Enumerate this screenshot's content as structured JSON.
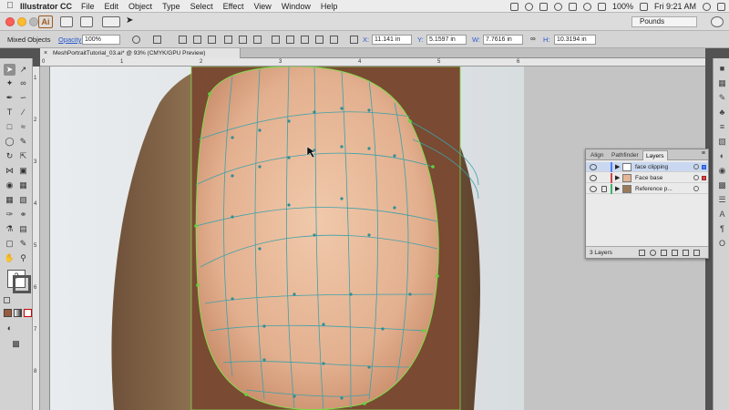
{
  "menubar": {
    "app_name": "Illustrator CC",
    "items": [
      "File",
      "Edit",
      "Object",
      "Type",
      "Select",
      "Effect",
      "View",
      "Window",
      "Help"
    ],
    "battery": "100%",
    "clock": "Fri 9:21 AM"
  },
  "appbar": {
    "logo": "Ai",
    "workspace": "Pounds"
  },
  "controlbar": {
    "selection_label": "Mixed Objects",
    "opacity_label": "Opacity",
    "opacity_value": "100%",
    "x_label": "X:",
    "x_value": "11.141 in",
    "y_label": "Y:",
    "y_value": "5.1597 in",
    "w_label": "W:",
    "w_value": "7.7616 in",
    "h_label": "H:",
    "h_value": "10.3194 in"
  },
  "document": {
    "tab_title": "MeshPortraitTutorial_03.ai* @ 93% (CMYK/GPU Preview)"
  },
  "rulers": {
    "top": [
      "0",
      "1",
      "2",
      "3",
      "4",
      "5",
      "6"
    ],
    "left": [
      "1",
      "2",
      "3",
      "4",
      "5",
      "6",
      "7",
      "8"
    ]
  },
  "layers_panel": {
    "tabs": [
      "Align",
      "Pathfinder",
      "Layers"
    ],
    "active_tab": "Layers",
    "layers": [
      {
        "name": "face clipping",
        "selected": true,
        "locked": false
      },
      {
        "name": "Face base",
        "selected": false,
        "locked": false
      },
      {
        "name": "Reference p...",
        "selected": false,
        "locked": true
      }
    ],
    "count": "3 Layers"
  },
  "colors": {
    "mesh_stroke": "#3ea0a8",
    "artboard_bounds": "#7fdc4a",
    "selection_blue": "#4f7fff",
    "skin": "#e7b898",
    "brown_backdrop": "#7a4a32"
  }
}
